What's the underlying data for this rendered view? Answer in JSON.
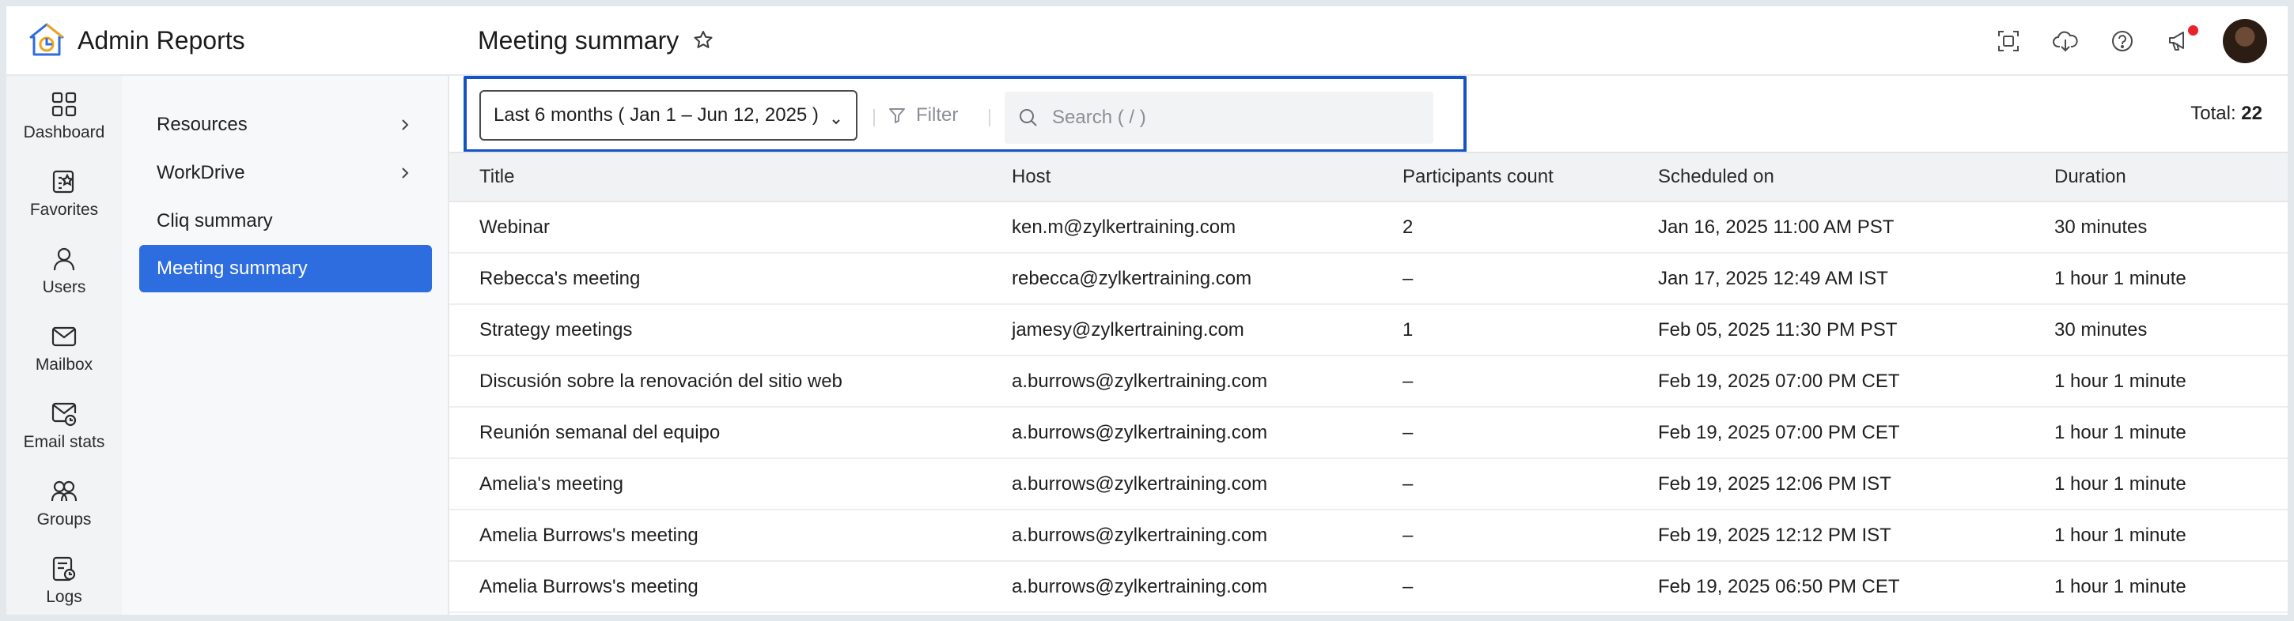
{
  "app": {
    "title": "Admin Reports",
    "accent_color": "#2d6de0",
    "highlight_color": "#1552c5"
  },
  "rail": {
    "items": [
      {
        "label": "Dashboard",
        "icon": "dashboard-grid-icon"
      },
      {
        "label": "Favorites",
        "icon": "favorites-list-icon"
      },
      {
        "label": "Users",
        "icon": "user-icon"
      },
      {
        "label": "Mailbox",
        "icon": "mail-icon"
      },
      {
        "label": "Email stats",
        "icon": "email-stats-icon"
      },
      {
        "label": "Groups",
        "icon": "groups-icon"
      },
      {
        "label": "Logs",
        "icon": "logs-icon"
      }
    ]
  },
  "submenu": {
    "items": [
      {
        "label": "Resources",
        "has_children": true
      },
      {
        "label": "WorkDrive",
        "has_children": true
      },
      {
        "label": "Cliq summary",
        "has_children": false
      },
      {
        "label": "Meeting summary",
        "has_children": false,
        "active": true
      }
    ]
  },
  "header": {
    "page_title": "Meeting summary",
    "icons": [
      "fullscreen-icon",
      "download-icon",
      "help-icon",
      "announcements-icon",
      "avatar"
    ]
  },
  "toolbar": {
    "date_range": "Last 6 months ( Jan 1 – Jun 12, 2025 )",
    "filter_label": "Filter",
    "search_placeholder": "Search ( / )",
    "total_label": "Total:",
    "total_value": "22"
  },
  "table": {
    "columns": [
      "Title",
      "Host",
      "Participants count",
      "Scheduled on",
      "Duration"
    ],
    "rows": [
      [
        "Webinar",
        "ken.m@zylkertraining.com",
        "2",
        "Jan 16, 2025 11:00 AM PST",
        "30 minutes"
      ],
      [
        "Rebecca's meeting",
        "rebecca@zylkertraining.com",
        "–",
        "Jan 17, 2025 12:49 AM IST",
        "1 hour 1 minute"
      ],
      [
        "Strategy meetings",
        "jamesy@zylkertraining.com",
        "1",
        "Feb 05, 2025 11:30 PM PST",
        "30 minutes"
      ],
      [
        "Discusión sobre la renovación del sitio web",
        "a.burrows@zylkertraining.com",
        "–",
        "Feb 19, 2025 07:00 PM CET",
        "1 hour 1 minute"
      ],
      [
        "Reunión semanal del equipo",
        "a.burrows@zylkertraining.com",
        "–",
        "Feb 19, 2025 07:00 PM CET",
        "1 hour 1 minute"
      ],
      [
        "Amelia's meeting",
        "a.burrows@zylkertraining.com",
        "–",
        "Feb 19, 2025 12:06 PM IST",
        "1 hour 1 minute"
      ],
      [
        "Amelia Burrows's meeting",
        "a.burrows@zylkertraining.com",
        "–",
        "Feb 19, 2025 12:12 PM IST",
        "1 hour 1 minute"
      ],
      [
        "Amelia Burrows's meeting",
        "a.burrows@zylkertraining.com",
        "–",
        "Feb 19, 2025 06:50 PM CET",
        "1 hour 1 minute"
      ]
    ]
  }
}
